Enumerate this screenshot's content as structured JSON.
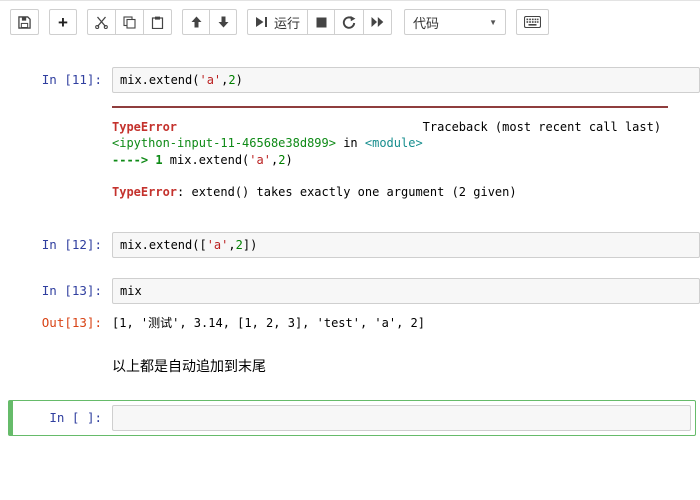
{
  "colors": {
    "prompt-in": "#303f9f",
    "prompt-out": "#d84315",
    "error-red": "#c4322d",
    "ansi-green": "#0e8a16",
    "ansi-cyan": "#178e8e",
    "string-red": "#ba2121",
    "number-green": "#008000",
    "selected-cell-green": "#66bb6a",
    "traceback-rule": "#8f3d3d",
    "input-bg": "#f7f7f7",
    "input-border": "#cfcfcf"
  },
  "toolbar": {
    "run_label": "运行",
    "cell_type": "代码"
  },
  "cells": {
    "cell11": {
      "prompt": "In [11]:",
      "code": [
        {
          "text": "mix.extend(",
          "type": "plain"
        },
        {
          "text": "'a'",
          "type": "string"
        },
        {
          "text": ",",
          "type": "plain"
        },
        {
          "text": "2",
          "type": "number"
        },
        {
          "text": ")",
          "type": "plain"
        }
      ],
      "traceback": {
        "lines": {
          "0": [
            {
              "text": "TypeError",
              "type": "error-bold"
            },
            {
              "text": "                                  Traceback (most recent call last)",
              "type": "plain"
            }
          ],
          "1": [
            {
              "text": "<ipython-input-11-46568e38d899>",
              "type": "green"
            },
            {
              "text": " in ",
              "type": "plain"
            },
            {
              "text": "<module>",
              "type": "cyan"
            }
          ],
          "2": [
            {
              "text": "----> 1",
              "type": "green-bold"
            },
            {
              "text": " mix.extend(",
              "type": "plain"
            },
            {
              "text": "'a'",
              "type": "string"
            },
            {
              "text": ",",
              "type": "plain"
            },
            {
              "text": "2",
              "type": "number"
            },
            {
              "text": ")",
              "type": "plain"
            }
          ],
          "3": [],
          "4": [
            {
              "text": "TypeError",
              "type": "error-bold"
            },
            {
              "text": ": extend() takes exactly one argument (2 given)",
              "type": "plain"
            }
          ]
        }
      }
    },
    "cell12": {
      "prompt": "In [12]:",
      "code": [
        {
          "text": "mix.extend([",
          "type": "plain"
        },
        {
          "text": "'a'",
          "type": "string"
        },
        {
          "text": ",",
          "type": "plain"
        },
        {
          "text": "2",
          "type": "number"
        },
        {
          "text": "])",
          "type": "plain"
        }
      ]
    },
    "cell13": {
      "prompt": "In [13]:",
      "code": [
        {
          "text": "mix",
          "type": "plain"
        }
      ]
    },
    "out13": {
      "prompt": "Out[13]:",
      "text": "[1, '测试', 3.14, [1, 2, 3], 'test', 'a', 2]"
    },
    "markdown": {
      "text": "以上都是自动追加到末尾"
    },
    "empty": {
      "prompt": "In [ ]:"
    }
  }
}
